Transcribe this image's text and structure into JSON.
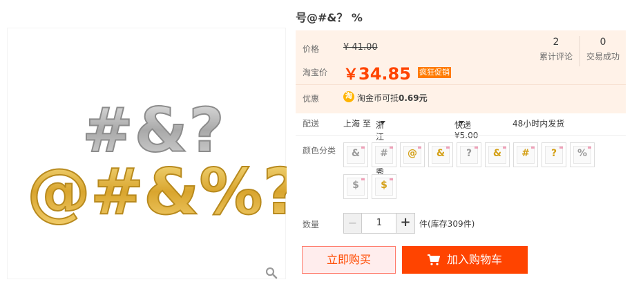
{
  "product": {
    "title": "号@#&？ %"
  },
  "price": {
    "orig_label": "价格",
    "orig_value": "¥ 41.00",
    "tb_label": "淘宝价",
    "currency": "￥",
    "tb_value": "34.85",
    "promo_tag": "疯狂促销"
  },
  "stats": [
    {
      "count": "2",
      "label": "累计评论"
    },
    {
      "count": "0",
      "label": "交易成功"
    }
  ],
  "coupon": {
    "label": "优惠",
    "icon_text": "淘",
    "text_prefix": "淘金币可抵",
    "amount": "0.69元"
  },
  "shipping": {
    "label": "配送",
    "from": "上海",
    "to_word": "至",
    "destination": "浙江嘉兴秀洲区",
    "method": "快递 ¥5.00",
    "delivery": "48小时内发货"
  },
  "colors": {
    "label": "颜色分类",
    "swatches": [
      {
        "glyph": "&",
        "tone": "silver"
      },
      {
        "glyph": "#",
        "tone": "silver"
      },
      {
        "glyph": "@",
        "tone": "gold"
      },
      {
        "glyph": "&",
        "tone": "gold"
      },
      {
        "glyph": "?",
        "tone": "silver"
      },
      {
        "glyph": "&",
        "tone": "gold"
      },
      {
        "glyph": "#",
        "tone": "gold"
      },
      {
        "glyph": "?",
        "tone": "gold"
      },
      {
        "glyph": "%",
        "tone": "silver"
      },
      {
        "glyph": "$",
        "tone": "silver"
      },
      {
        "glyph": "$",
        "tone": "gold"
      }
    ]
  },
  "quantity": {
    "label": "数量",
    "minus": "−",
    "value": "1",
    "plus": "+",
    "stock": "件(库存309件)"
  },
  "actions": {
    "buy_now": "立即购买",
    "add_to_cart": "加入购物车"
  },
  "image": {
    "top_row": "#&?",
    "bottom_row": "@#&%?",
    "colors": {
      "silver": "#b8b8b8",
      "gold": "#e0b43a"
    }
  }
}
